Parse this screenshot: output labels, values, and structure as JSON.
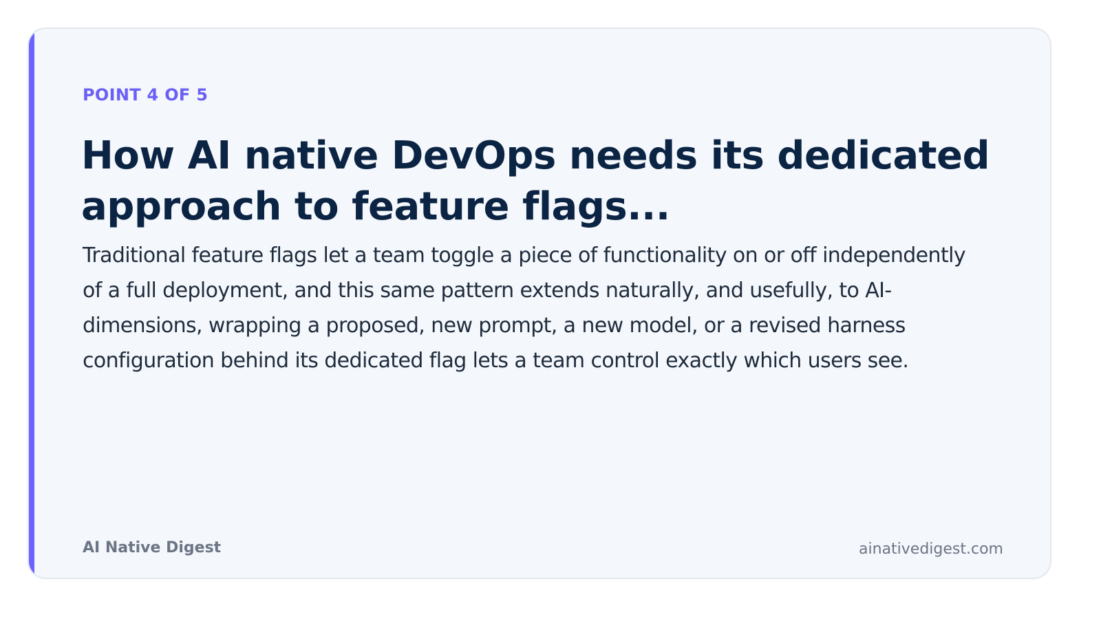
{
  "card": {
    "eyebrow": "POINT 4 OF 5",
    "title": "How AI native DevOps needs its dedicated approach to feature flags...",
    "body": "Traditional feature flags let a team toggle a piece of functionality on or off independently of a full deployment, and this same pattern extends naturally, and usefully, to AI-dimensions, wrapping a proposed, new prompt, a new model, or a revised harness configuration behind its dedicated flag lets a team control exactly which users see."
  },
  "footer": {
    "brand": "AI Native Digest",
    "site": "ainativedigest.com"
  },
  "colors": {
    "accent": "#6c63ff",
    "title": "#0c2444",
    "body": "#1f2c3d",
    "muted": "#6c7585",
    "card_background": "#f4f7fb"
  }
}
